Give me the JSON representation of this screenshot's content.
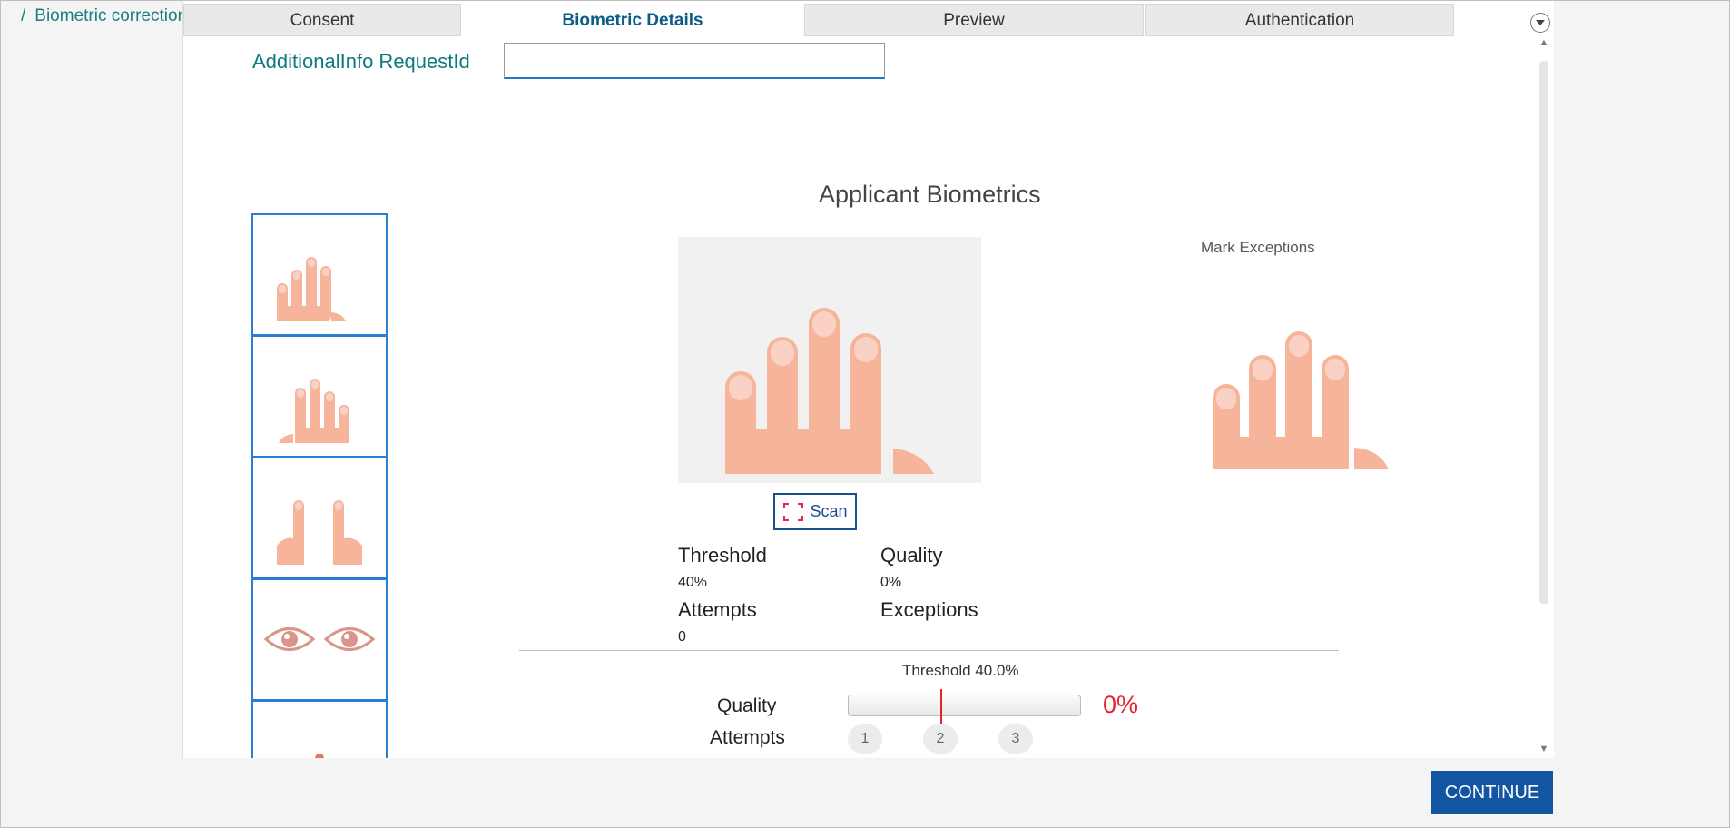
{
  "breadcrumb": {
    "separator": "/",
    "label": "Biometric correction"
  },
  "tabs": [
    {
      "label": "Consent"
    },
    {
      "label": "Biometric Details"
    },
    {
      "label": "Preview"
    },
    {
      "label": "Authentication"
    }
  ],
  "active_tab": "Biometric Details",
  "form": {
    "additional_info_label": "AdditionalInfo RequestId",
    "additional_info_value": "",
    "additional_info_placeholder": ""
  },
  "biometrics": {
    "title": "Applicant Biometrics",
    "scan_label": "Scan",
    "mark_exceptions_label": "Mark Exceptions",
    "threshold_label": "Threshold",
    "threshold_value": "40%",
    "quality_label": "Quality",
    "quality_value": "0%",
    "attempts_label": "Attempts",
    "attempts_value": "0",
    "exceptions_label": "Exceptions"
  },
  "quality_panel": {
    "threshold_text": "Threshold  40.0%",
    "quality_label": "Quality",
    "quality_percent": "0%",
    "quality_fraction": 0,
    "threshold_fraction": 0.4,
    "attempts_label": "Attempts",
    "attempts": [
      "1",
      "2",
      "3"
    ]
  },
  "thumbnails": [
    {
      "name": "left-hand-fingers"
    },
    {
      "name": "right-hand-fingers"
    },
    {
      "name": "thumbs"
    },
    {
      "name": "iris"
    },
    {
      "name": "face"
    }
  ],
  "continue_label": "CONTINUE",
  "colors": {
    "accent": "#1255a2",
    "teal_text": "#0c7a7e",
    "hand": "#f6b49a",
    "nail": "#f9d2c5",
    "error": "#e3242b"
  }
}
